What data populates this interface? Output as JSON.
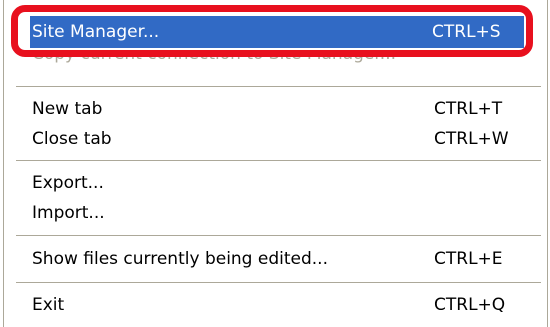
{
  "menu": {
    "items": [
      {
        "label": "Site Manager...",
        "shortcut": "CTRL+S"
      },
      {
        "label": "Copy current connection to Site Manager...",
        "shortcut": ""
      },
      {
        "label": "New tab",
        "shortcut": "CTRL+T"
      },
      {
        "label": "Close tab",
        "shortcut": "CTRL+W"
      },
      {
        "label": "Export...",
        "shortcut": ""
      },
      {
        "label": "Import...",
        "shortcut": ""
      },
      {
        "label": "Show files currently being edited...",
        "shortcut": "CTRL+E"
      },
      {
        "label": "Exit",
        "shortcut": "CTRL+Q"
      }
    ]
  },
  "colors": {
    "highlight": "#316ac5",
    "callout": "#e8101e",
    "disabled": "#aca899"
  }
}
